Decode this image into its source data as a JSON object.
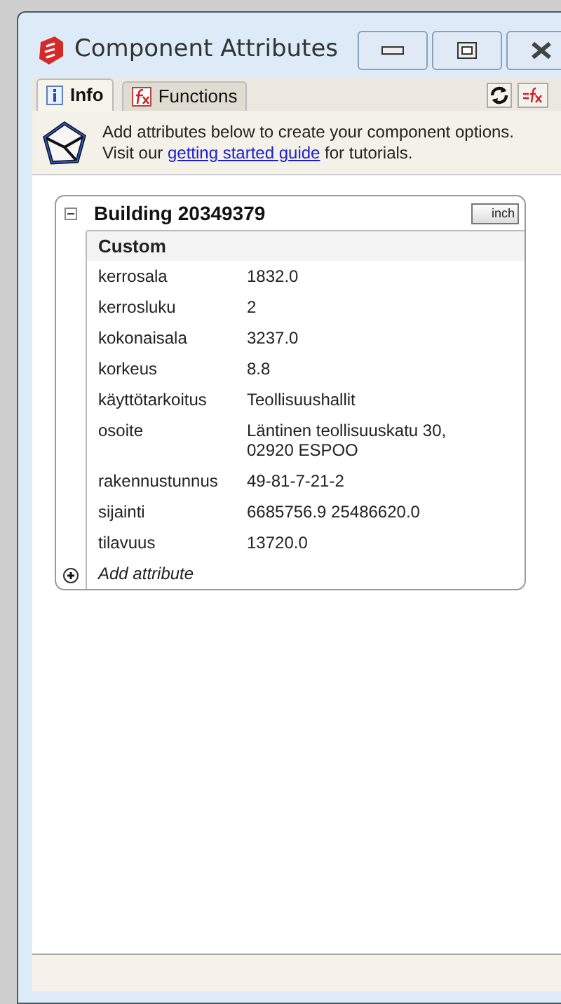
{
  "window": {
    "title": "Component Attributes"
  },
  "tabs": [
    {
      "label": "Info",
      "selected": true
    },
    {
      "label": "Functions",
      "selected": false
    }
  ],
  "banner": {
    "line1": "Add attributes below to create your component options.",
    "line2_before": "Visit our ",
    "link": "getting started guide",
    "line2_after": " for tutorials."
  },
  "component": {
    "name": "Building 20349379",
    "expanded": true,
    "units": "inch",
    "section": "Custom",
    "add_label": "Add attribute",
    "attributes": [
      {
        "name": "kerrosala",
        "value": "1832.0"
      },
      {
        "name": "kerrosluku",
        "value": "2"
      },
      {
        "name": "kokonaisala",
        "value": "3237.0"
      },
      {
        "name": "korkeus",
        "value": "8.8"
      },
      {
        "name": "käyttötarkoitus",
        "value": "Teollisuushallit"
      },
      {
        "name": "osoite",
        "value": "Läntinen teollisuuskatu 30, 02920 ESPOO"
      },
      {
        "name": "rakennustunnus",
        "value": "49-81-7-21-2"
      },
      {
        "name": "sijainti",
        "value": "6685756.9 25486620.0"
      },
      {
        "name": "tilavuus",
        "value": "13720.0"
      }
    ]
  }
}
